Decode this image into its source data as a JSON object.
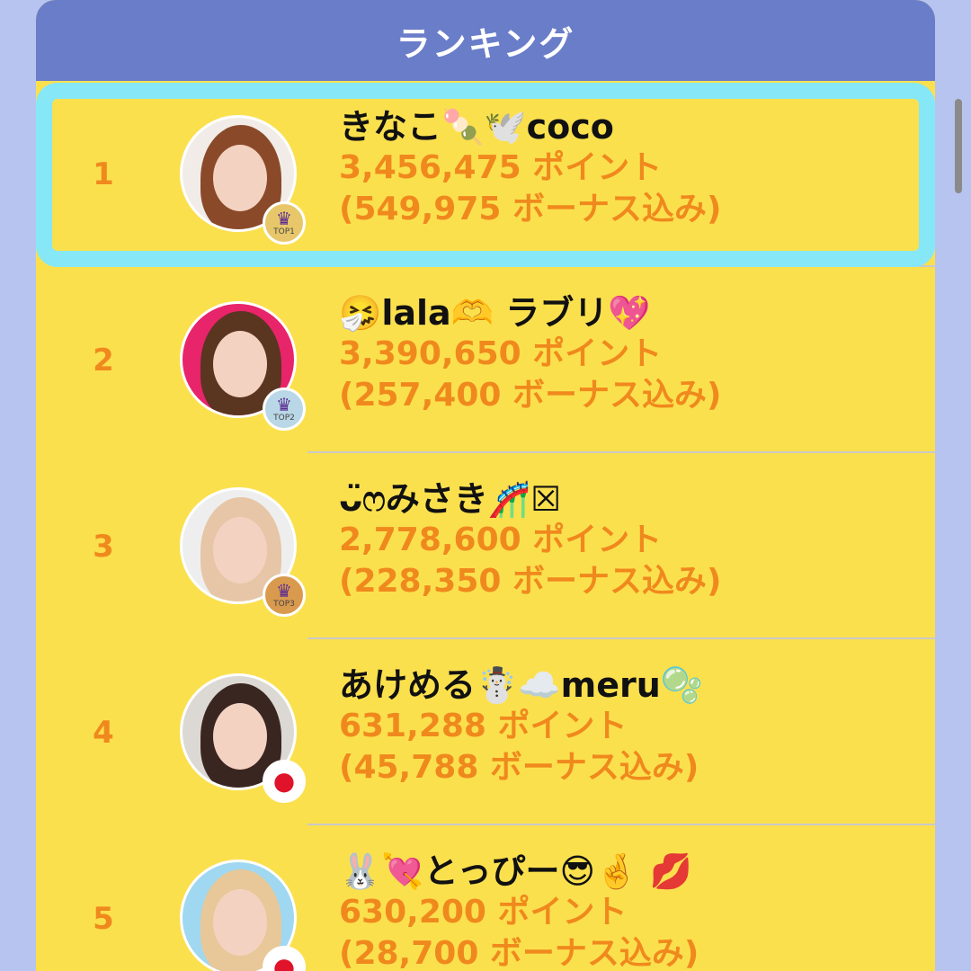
{
  "header": {
    "title": "ランキング"
  },
  "colors": {
    "background": "#b7c4ef",
    "header": "#6a7dc9",
    "list": "#fbe04e",
    "accent_text": "#f0891d",
    "selection_border": "#86e7f6"
  },
  "ranking": [
    {
      "rank": "1",
      "name": "きなこ🍡🕊️coco",
      "points": "3,456,475 ポイント",
      "bonus": "(549,975 ボーナス込み)",
      "badge": "TOP1",
      "badge_icon": "crown-icon",
      "badge_color": "#e8c76a",
      "avatar_bg": "#f2ece8",
      "hair_color": "#8a4a2a",
      "selected": true
    },
    {
      "rank": "2",
      "name": "🤧lala🫶 ラブリ💖",
      "points": "3,390,650 ポイント",
      "bonus": "(257,400 ボーナス込み)",
      "badge": "TOP2",
      "badge_icon": "crown-icon",
      "badge_color": "#b9d7e6",
      "avatar_bg": "#e8246a",
      "hair_color": "#5a3520",
      "selected": false
    },
    {
      "rank": "3",
      "name": "ᴗ̈ෆみさき🎢☒",
      "points": "2,778,600 ポイント",
      "bonus": "(228,350 ボーナス込み)",
      "badge": "TOP3",
      "badge_icon": "crown-icon",
      "badge_color": "#d99a4e",
      "avatar_bg": "#eeeeee",
      "hair_color": "#e6c6a6",
      "selected": false
    },
    {
      "rank": "4",
      "name": "あけめる☃️☁️meru🫧",
      "points": "631,288 ポイント",
      "bonus": "(45,788 ボーナス込み)",
      "badge": "",
      "badge_icon": "apple-icon",
      "badge_color": "#ffffff",
      "avatar_bg": "#dcd8d4",
      "hair_color": "#3a2620",
      "selected": false
    },
    {
      "rank": "5",
      "name": "🐰💘とっぴー😎🤞 💋",
      "points": "630,200 ポイント",
      "bonus": "(28,700 ボーナス込み)",
      "badge": "",
      "badge_icon": "apple-icon",
      "badge_color": "#ffffff",
      "avatar_bg": "#9fd8f0",
      "hair_color": "#e8c898",
      "selected": false
    }
  ]
}
